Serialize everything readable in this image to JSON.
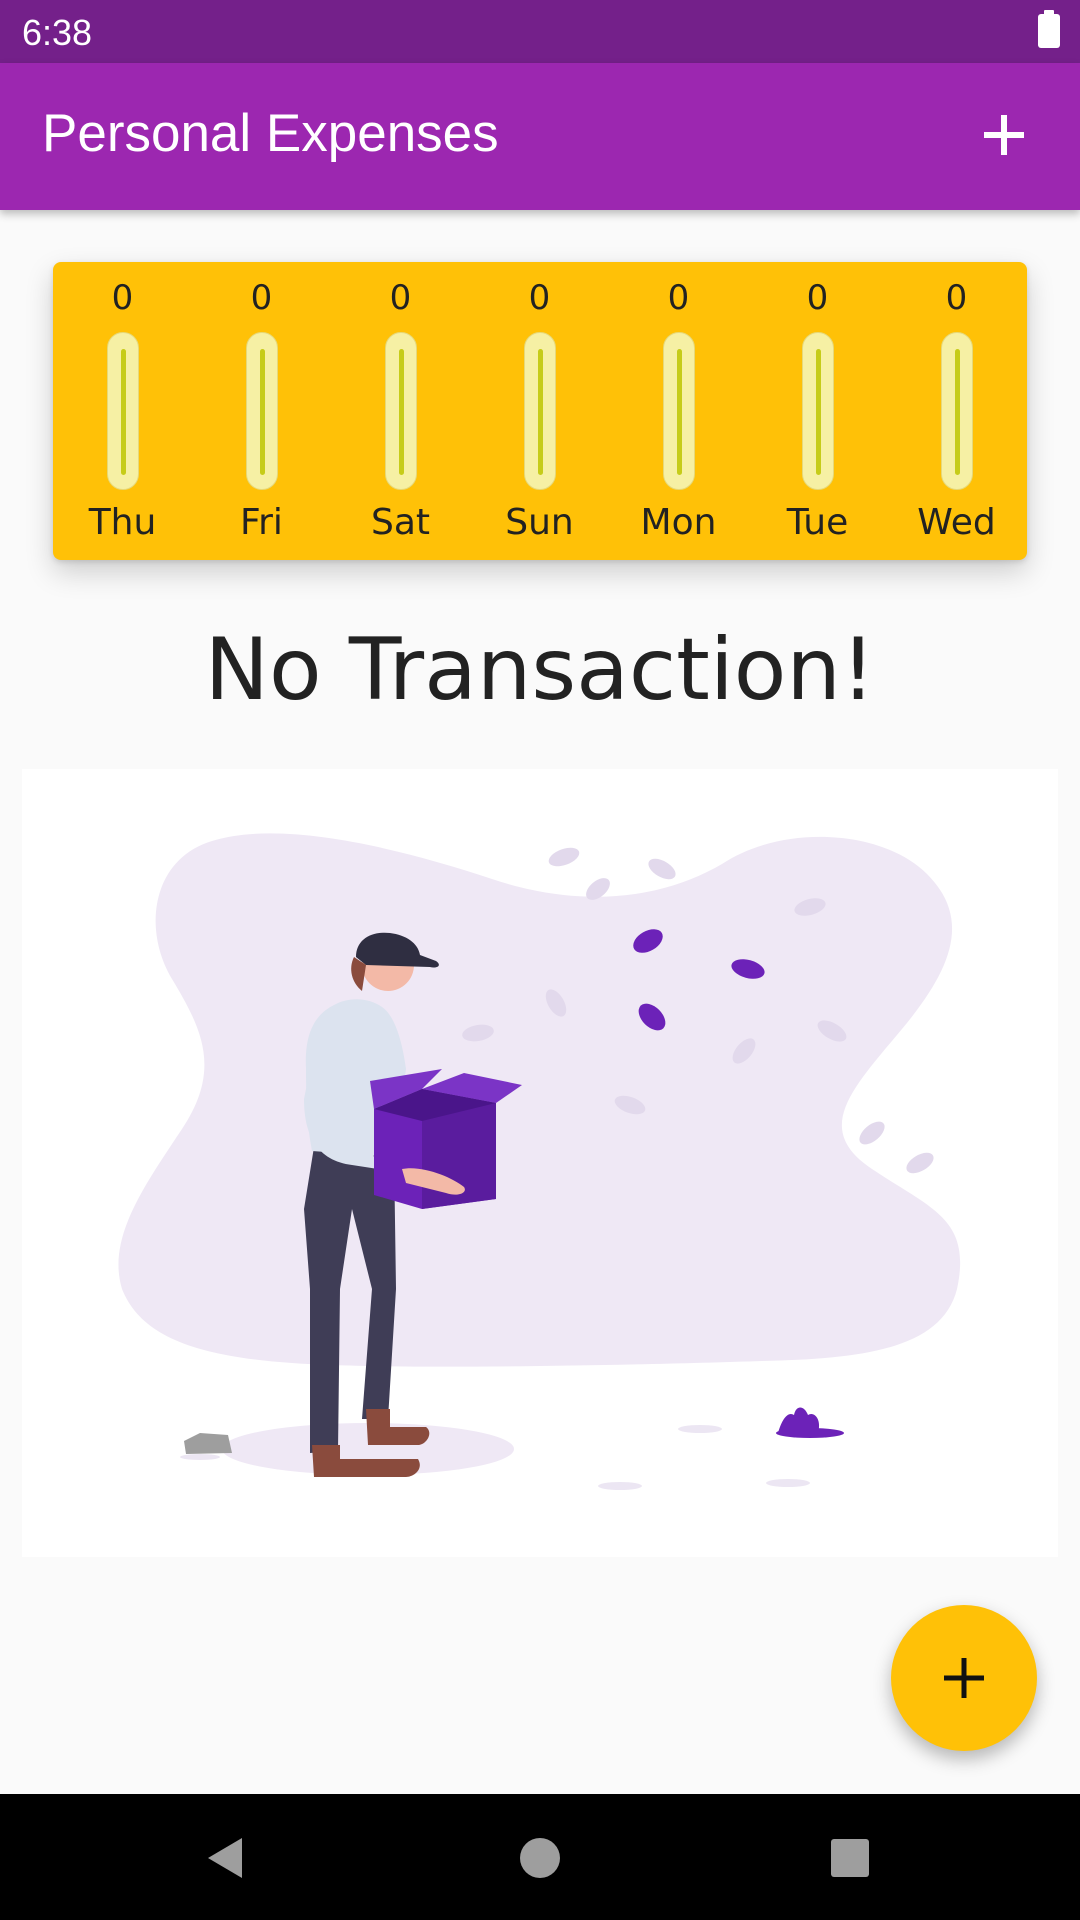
{
  "status_bar": {
    "time": "6:38",
    "battery_icon": "battery-full-icon"
  },
  "app_bar": {
    "title": "Personal Expenses",
    "add_icon": "plus-icon"
  },
  "chart": {
    "colors": {
      "card": "#ffc107",
      "track": "#f6f0a4",
      "fill": "#9c27b0"
    },
    "days": [
      {
        "label": "Thu",
        "amount": "0",
        "fraction": 0
      },
      {
        "label": "Fri",
        "amount": "0",
        "fraction": 0
      },
      {
        "label": "Sat",
        "amount": "0",
        "fraction": 0
      },
      {
        "label": "Sun",
        "amount": "0",
        "fraction": 0
      },
      {
        "label": "Mon",
        "amount": "0",
        "fraction": 0
      },
      {
        "label": "Tue",
        "amount": "0",
        "fraction": 0
      },
      {
        "label": "Wed",
        "amount": "0",
        "fraction": 0
      }
    ]
  },
  "empty_state": {
    "title": "No Transaction!",
    "illustration": "person-opening-empty-box-illustration"
  },
  "fab": {
    "icon": "plus-icon",
    "color": "#ffc107"
  },
  "nav_bar": {
    "back_icon": "back-triangle-icon",
    "home_icon": "home-circle-icon",
    "recents_icon": "recents-square-icon"
  },
  "theme": {
    "primary": "#9c27b0",
    "primary_dark": "#74208a",
    "accent": "#ffc107",
    "illustration_accent": "#6c22b8"
  }
}
